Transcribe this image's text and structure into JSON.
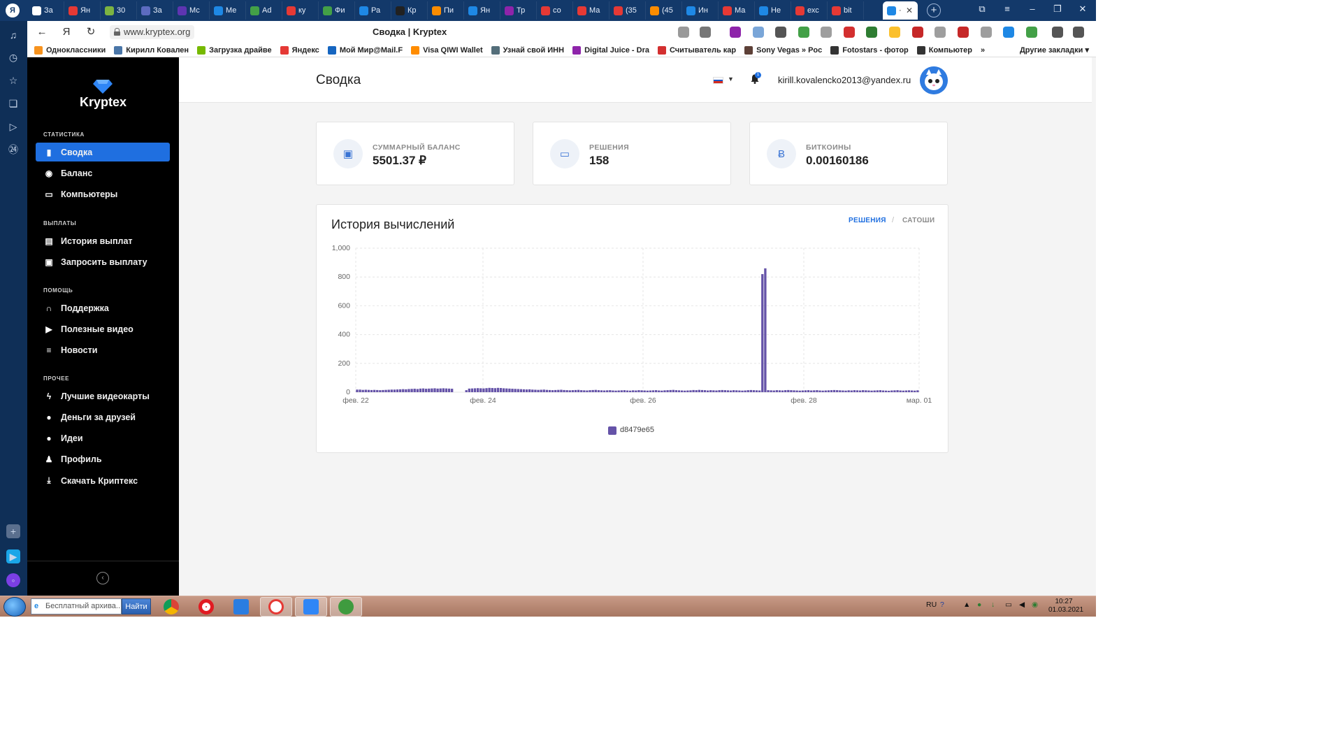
{
  "browser": {
    "logo": "Я",
    "tabs": [
      {
        "label": "За",
        "color": "#ffffff"
      },
      {
        "label": "Ян",
        "color": "#e53935"
      },
      {
        "label": "30",
        "color": "#7cb342"
      },
      {
        "label": "За",
        "color": "#5c6bc0"
      },
      {
        "label": "Мс",
        "color": "#5e35b1"
      },
      {
        "label": "Ме",
        "color": "#1e88e5"
      },
      {
        "label": "Ad",
        "color": "#43a047"
      },
      {
        "label": "ку",
        "color": "#e53935"
      },
      {
        "label": "Фи",
        "color": "#43a047"
      },
      {
        "label": "Ра",
        "color": "#1e88e5"
      },
      {
        "label": "Кр",
        "color": "#212121"
      },
      {
        "label": "Пи",
        "color": "#fb8c00"
      },
      {
        "label": "Ян",
        "color": "#1e88e5"
      },
      {
        "label": "Тр",
        "color": "#8e24aa"
      },
      {
        "label": "со",
        "color": "#e53935"
      },
      {
        "label": "Ма",
        "color": "#e53935"
      },
      {
        "label": "(35",
        "color": "#e53935"
      },
      {
        "label": "(45",
        "color": "#fb8c00"
      },
      {
        "label": "Ин",
        "color": "#1e88e5"
      },
      {
        "label": "Ма",
        "color": "#e53935"
      },
      {
        "label": "Не",
        "color": "#1e88e5"
      },
      {
        "label": "ехс",
        "color": "#e53935"
      },
      {
        "label": "bit",
        "color": "#e53935"
      }
    ],
    "active_tab_color": "#1e88e5",
    "new_tab": "+",
    "url": "www.kryptex.org",
    "page_title": "Сводка | Kryptex",
    "bookmarks": [
      {
        "label": "Одноклассники",
        "color": "#f7931e"
      },
      {
        "label": "Кирилл Ковален",
        "color": "#4a76a8"
      },
      {
        "label": "Загрузка драйве",
        "color": "#76b900"
      },
      {
        "label": "Яндекс",
        "color": "#e53935"
      },
      {
        "label": "Мой Мир@Mail.F",
        "color": "#1565c0"
      },
      {
        "label": "Visa QIWI Wallet",
        "color": "#ff8c00"
      },
      {
        "label": "Узнай свой ИНН",
        "color": "#546e7a"
      },
      {
        "label": "Digital Juice - Dra",
        "color": "#8e24aa"
      },
      {
        "label": "Считыватель кар",
        "color": "#d32f2f"
      },
      {
        "label": "Sony Vegas » Poc",
        "color": "#5d4037"
      },
      {
        "label": "Fotostars - фотор",
        "color": "#333333"
      },
      {
        "label": "Компьютер",
        "color": "#333333"
      }
    ],
    "bookmarks_more": "»",
    "other_bookmarks": "Другие закладки"
  },
  "app": {
    "brand": "Kryptex",
    "brand_color": "#1f6fe0",
    "sections": [
      {
        "title": "СТАТИСТИКА",
        "items": [
          {
            "label": "Сводка",
            "icon": "bar-chart-icon",
            "active": true
          },
          {
            "label": "Баланс",
            "icon": "piggy-bank-icon"
          },
          {
            "label": "Компьютеры",
            "icon": "monitor-icon"
          }
        ]
      },
      {
        "title": "ВЫПЛАТЫ",
        "items": [
          {
            "label": "История выплат",
            "icon": "book-icon"
          },
          {
            "label": "Запросить выплату",
            "icon": "wallet-icon"
          }
        ]
      },
      {
        "title": "ПОМОЩЬ",
        "items": [
          {
            "label": "Поддержка",
            "icon": "headset-icon"
          },
          {
            "label": "Полезные видео",
            "icon": "play-icon"
          },
          {
            "label": "Новости",
            "icon": "list-icon"
          }
        ]
      },
      {
        "title": "ПРОЧЕЕ",
        "items": [
          {
            "label": "Лучшие видеокарты",
            "icon": "bolt-icon"
          },
          {
            "label": "Деньги за друзей",
            "icon": "hand-coin-icon"
          },
          {
            "label": "Идеи",
            "icon": "bulb-icon"
          },
          {
            "label": "Профиль",
            "icon": "user-icon"
          },
          {
            "label": "Скачать Криптекс",
            "icon": "download-icon"
          }
        ]
      }
    ]
  },
  "header": {
    "title": "Сводка",
    "notifications": "1",
    "email": "kirill.kovalencko2013@yandex.ru"
  },
  "cards": [
    {
      "label": "СУММАРНЫЙ БАЛАНС",
      "value": "5501.37 ₽",
      "icon": "wallet-icon"
    },
    {
      "label": "РЕШЕНИЯ",
      "value": "158",
      "icon": "card-icon"
    },
    {
      "label": "БИТКОИНЫ",
      "value": "0.00160186",
      "icon": "bitcoin-icon"
    }
  ],
  "chart": {
    "title": "История вычислений",
    "tabs": [
      {
        "label": "РЕШЕНИЯ",
        "active": true
      },
      {
        "label": "САТОШИ",
        "active": false
      }
    ],
    "separator": "/"
  },
  "chart_data": {
    "type": "bar",
    "ylim": [
      0,
      1000
    ],
    "y_ticks": [
      "0",
      "200",
      "400",
      "600",
      "800",
      "1,000"
    ],
    "x_ticks": [
      "фев. 22",
      "фев. 24",
      "фев. 26",
      "фев. 28",
      "мар. 01"
    ],
    "grid": true,
    "legend": "bottom-center",
    "series": [
      {
        "name": "d8479e65",
        "color": "#6553a8",
        "values": [
          18,
          18,
          16,
          17,
          16,
          15,
          16,
          15,
          14,
          15,
          16,
          17,
          18,
          18,
          19,
          20,
          21,
          20,
          22,
          23,
          24,
          22,
          25,
          26,
          24,
          25,
          26,
          27,
          25,
          26,
          27,
          26,
          25,
          24,
          0,
          0,
          0,
          0,
          14,
          25,
          26,
          27,
          28,
          27,
          26,
          28,
          30,
          29,
          28,
          30,
          29,
          27,
          26,
          25,
          24,
          23,
          22,
          21,
          20,
          19,
          20,
          18,
          17,
          16,
          17,
          18,
          16,
          15,
          14,
          15,
          16,
          17,
          15,
          14,
          13,
          14,
          15,
          16,
          14,
          13,
          12,
          14,
          15,
          16,
          14,
          13,
          12,
          13,
          14,
          12,
          11,
          12,
          13,
          14,
          12,
          11,
          13,
          12,
          14,
          13,
          12,
          11,
          12,
          13,
          14,
          12,
          11,
          13,
          14,
          15,
          16,
          14,
          13,
          12,
          11,
          12,
          13,
          15,
          14,
          16,
          15,
          14,
          12,
          14,
          13,
          12,
          14,
          15,
          14,
          13,
          12,
          14,
          13,
          12,
          11,
          12,
          14,
          15,
          14,
          13,
          12,
          820,
          860,
          14,
          13,
          12,
          14,
          13,
          12,
          14,
          15,
          14,
          13,
          12,
          11,
          12,
          13,
          14,
          12,
          13,
          14,
          12,
          11,
          12,
          13,
          14,
          15,
          14,
          13,
          12,
          11,
          13,
          12,
          14,
          13,
          12,
          14,
          13,
          12,
          11,
          12,
          13,
          14,
          12,
          11,
          10,
          12,
          13,
          14,
          12,
          11,
          12,
          13,
          12,
          11,
          13
        ]
      }
    ]
  },
  "taskbar": {
    "search_placeholder": "Бесплатный архива...",
    "search_button": "Найти",
    "lang": "RU",
    "time": "10:27",
    "date": "01.03.2021"
  }
}
